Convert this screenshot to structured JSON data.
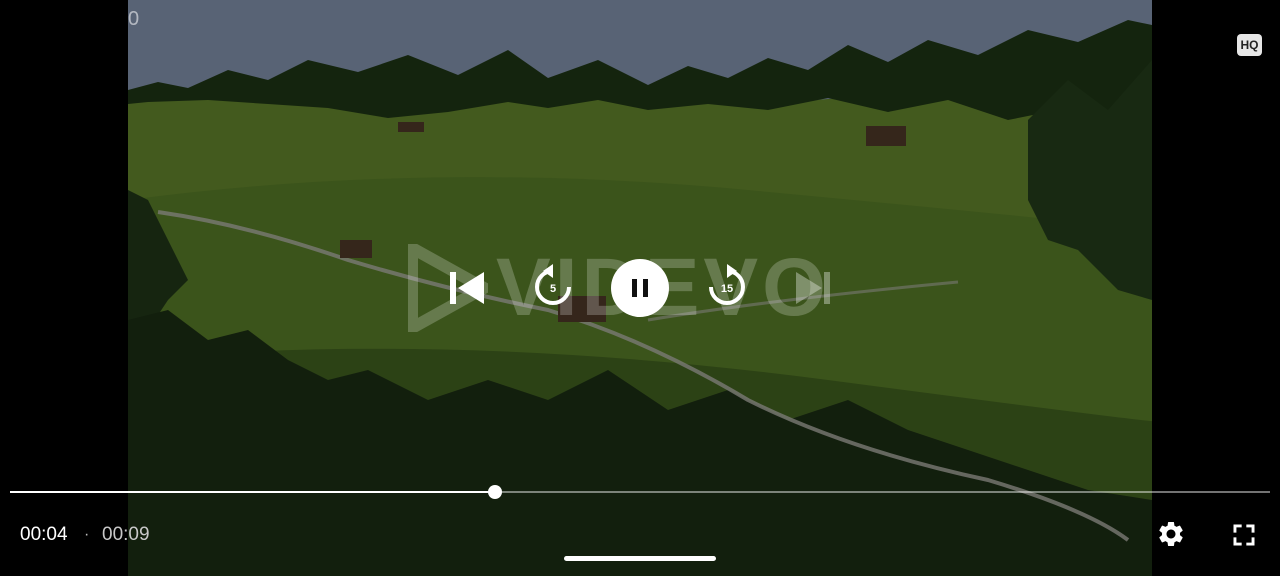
{
  "video": {
    "corner_text": "0",
    "quality_badge": "HQ",
    "watermark": "VIDEVO"
  },
  "controls": {
    "previous_icon": "skip-previous-icon",
    "rewind_seconds": "5",
    "rewind_icon": "replay-icon",
    "play_state": "playing",
    "pause_icon": "pause-icon",
    "forward_seconds": "15",
    "forward_icon": "forward-icon",
    "next_icon": "skip-next-icon",
    "next_enabled": false
  },
  "progress": {
    "current_time": "00:04",
    "separator": "·",
    "total_time": "00:09",
    "played_fraction": 0.385
  },
  "bottom_bar": {
    "settings_icon": "gear-icon",
    "fullscreen_icon": "fullscreen-icon"
  },
  "colors": {
    "accent": "#ffffff",
    "track": "#8a8a8a",
    "background": "#000000"
  }
}
